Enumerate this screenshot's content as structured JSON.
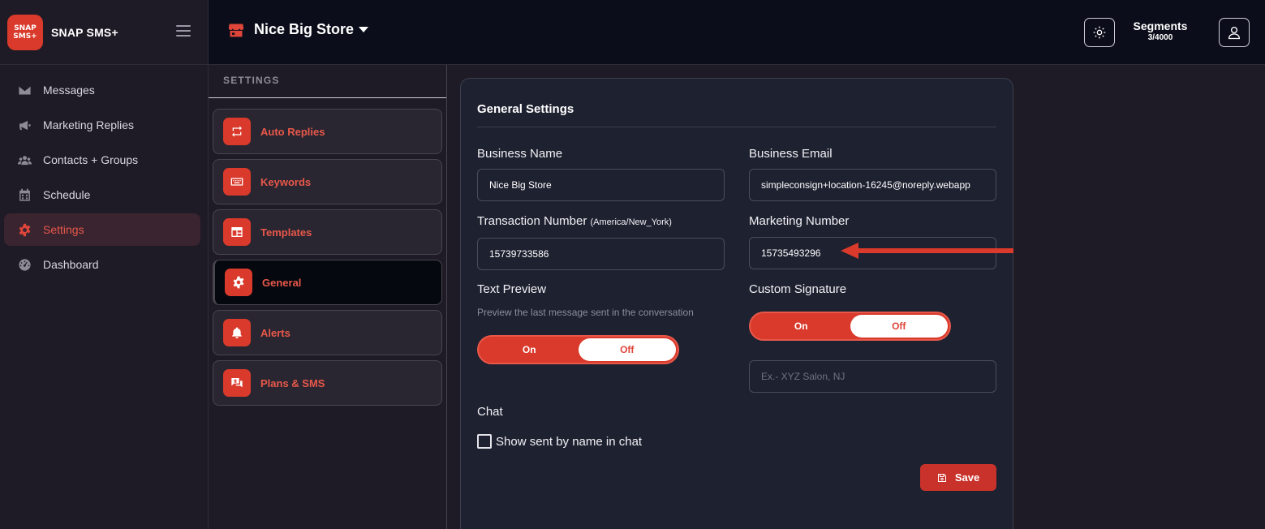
{
  "brand": {
    "logo_line1": "SNAP",
    "logo_line2": "SMS+",
    "name": "SNAP SMS+"
  },
  "sidebar": {
    "items": [
      {
        "label": "Messages",
        "icon": "envelope-icon"
      },
      {
        "label": "Marketing Replies",
        "icon": "megaphone-icon"
      },
      {
        "label": "Contacts + Groups",
        "icon": "users-icon"
      },
      {
        "label": "Schedule",
        "icon": "calendar-icon"
      },
      {
        "label": "Settings",
        "icon": "gear-icon",
        "active": true
      },
      {
        "label": "Dashboard",
        "icon": "gauge-icon"
      }
    ]
  },
  "topbar": {
    "store_name": "Nice Big Store",
    "segments_title": "Segments",
    "segments_count": "3/4000"
  },
  "settings_panel": {
    "header": "SETTINGS",
    "items": [
      {
        "label": "Auto Replies",
        "icon": "repeat-icon"
      },
      {
        "label": "Keywords",
        "icon": "keyboard-icon"
      },
      {
        "label": "Templates",
        "icon": "template-icon"
      },
      {
        "label": "General",
        "icon": "gear-icon",
        "active": true
      },
      {
        "label": "Alerts",
        "icon": "bell-icon"
      },
      {
        "label": "Plans & SMS",
        "icon": "chat-dollar-icon"
      }
    ]
  },
  "general": {
    "title": "General Settings",
    "business_name_label": "Business Name",
    "business_name_value": "Nice Big Store",
    "business_email_label": "Business Email",
    "business_email_value": "simpleconsign+location-16245@noreply.webapp",
    "transaction_number_label": "Transaction Number",
    "transaction_timezone": "(America/New_York)",
    "transaction_number_value": "15739733586",
    "marketing_number_label": "Marketing Number",
    "marketing_number_value": "15735493296",
    "text_preview_label": "Text Preview",
    "text_preview_hint": "Preview the last message sent in the conversation",
    "text_preview_on": "On",
    "text_preview_off": "Off",
    "text_preview_selected": "Off",
    "custom_signature_label": "Custom Signature",
    "custom_signature_on": "On",
    "custom_signature_off": "Off",
    "custom_signature_selected": "Off",
    "signature_placeholder": "Ex.- XYZ Salon, NJ",
    "chat_label": "Chat",
    "show_sent_by_label": "Show sent by name in chat",
    "show_sent_by_checked": false,
    "save_label": "Save"
  },
  "colors": {
    "accent": "#d93a2b",
    "accent_text": "#e8584a",
    "topbar_bg": "#0b0e1a",
    "sidebar_bg": "#1e1b26",
    "card_bg": "#1e2130"
  }
}
